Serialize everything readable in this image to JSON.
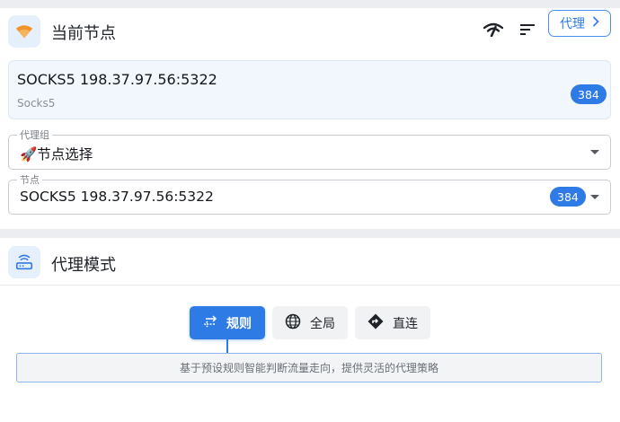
{
  "current_node": {
    "title": "当前节点",
    "proxy_button_label": "代理",
    "node_name": "SOCKS5 198.37.97.56:5322",
    "node_type": "Socks5",
    "delay": "384"
  },
  "proxy_group": {
    "legend": "代理组",
    "value": "🚀节点选择"
  },
  "node_select": {
    "legend": "节点",
    "value": "SOCKS5 198.37.97.56:5322",
    "delay": "384"
  },
  "proxy_mode": {
    "title": "代理模式",
    "modes": [
      {
        "label": "规则",
        "icon": "swap-arrows-icon",
        "active": true
      },
      {
        "label": "全局",
        "icon": "globe-icon",
        "active": false
      },
      {
        "label": "直连",
        "icon": "direction-arrow-icon",
        "active": false
      }
    ],
    "description": "基于预设规则智能判断流量走向，提供灵活的代理策略"
  },
  "colors": {
    "accent": "#2f7be6",
    "wifi_orange": "#f0932b",
    "icon_bg": "#e6effc"
  }
}
